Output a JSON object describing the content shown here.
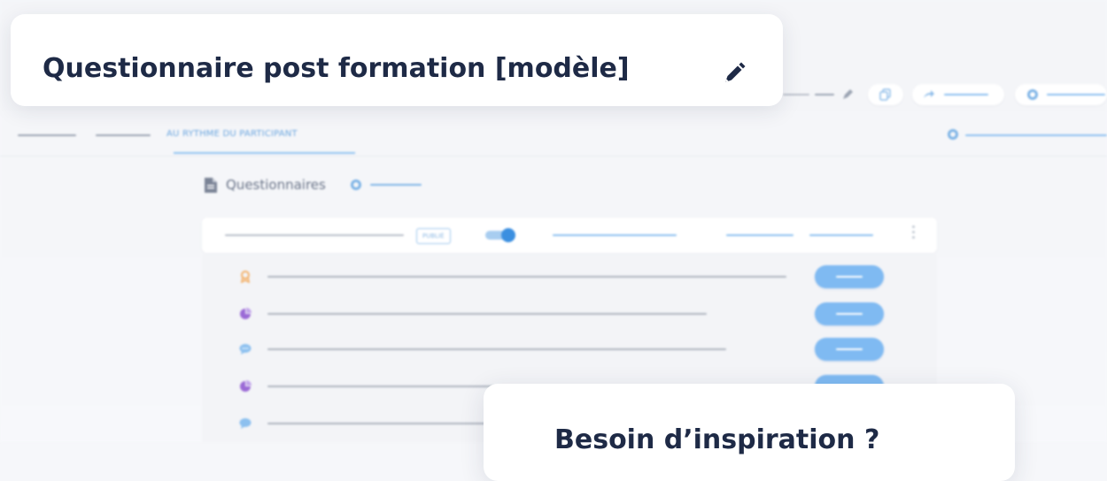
{
  "header": {
    "title": "Questionnaire post formation [modèle]",
    "edit_icon": "pencil-icon"
  },
  "tabs": {
    "active_label": "AU RYTHME DU PARTICIPANT"
  },
  "section": {
    "title": "Questionnaires",
    "icon": "document-icon"
  },
  "toolbar": {
    "status_badge": "PUBLIÉ",
    "toggle_on": true
  },
  "list": {
    "rows": [
      {
        "icon": "award-icon",
        "icon_color": "#f3b26b"
      },
      {
        "icon": "pie-chart-icon",
        "icon_color": "#9b6ad6"
      },
      {
        "icon": "chat-bubble-icon",
        "icon_color": "#8cc0ef"
      },
      {
        "icon": "pie-chart-icon",
        "icon_color": "#9b6ad6"
      },
      {
        "icon": "chat-bubble-icon",
        "icon_color": "#8cc0ef"
      }
    ]
  },
  "callout": {
    "text": "Besoin d’inspiration ?"
  },
  "colors": {
    "accent": "#3b8fe0",
    "title": "#1e2a46",
    "button": "#7fbaf2"
  }
}
